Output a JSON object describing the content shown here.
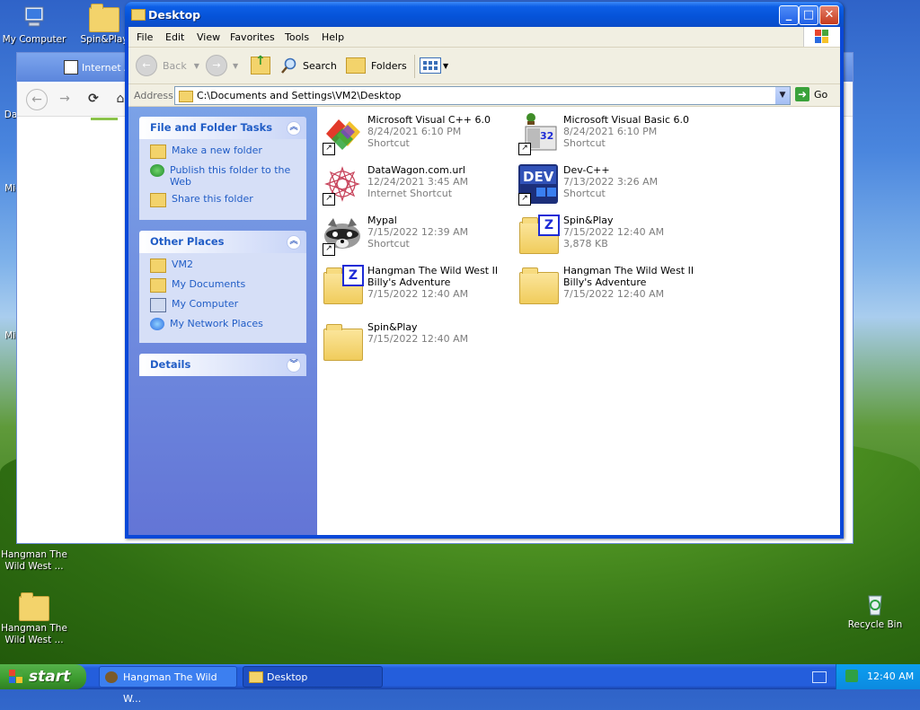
{
  "desktop": {
    "icons": [
      {
        "label": "My Computer"
      },
      {
        "label": "Spin&Play"
      },
      {
        "label": "Hangman The Wild West ..."
      },
      {
        "label": "Hangman The Wild West ..."
      },
      {
        "label": "Recycle Bin"
      }
    ],
    "partial_labels": [
      "Da",
      "Mic",
      "Mic"
    ]
  },
  "background_window": {
    "title": "Internet A"
  },
  "window": {
    "title": "Desktop",
    "controls": {
      "minimize": "_",
      "maximize": "□",
      "close": "✕"
    }
  },
  "menubar": [
    "File",
    "Edit",
    "View",
    "Favorites",
    "Tools",
    "Help"
  ],
  "toolbar": {
    "back": "Back",
    "search": "Search",
    "folders": "Folders"
  },
  "address": {
    "label": "Address",
    "value": "C:\\Documents and Settings\\VM2\\Desktop",
    "go": "Go"
  },
  "tasks_panel": {
    "title": "File and Folder Tasks",
    "links": [
      "Make a new folder",
      "Publish this folder to the Web",
      "Share this folder"
    ]
  },
  "places_panel": {
    "title": "Other Places",
    "links": [
      "VM2",
      "My Documents",
      "My Computer",
      "My Network Places"
    ]
  },
  "details_panel": {
    "title": "Details"
  },
  "files": [
    {
      "name": "Microsoft Visual C++ 6.0",
      "line2": "8/24/2021 6:10 PM",
      "line3": "Shortcut"
    },
    {
      "name": "Microsoft Visual Basic 6.0",
      "line2": "8/24/2021 6:10 PM",
      "line3": "Shortcut"
    },
    {
      "name": "DataWagon.com.url",
      "line2": "12/24/2021 3:45 AM",
      "line3": "Internet Shortcut"
    },
    {
      "name": "Dev-C++",
      "line2": "7/13/2022 3:26 AM",
      "line3": "Shortcut"
    },
    {
      "name": "Mypal",
      "line2": "7/15/2022 12:39 AM",
      "line3": "Shortcut"
    },
    {
      "name": "Spin&Play",
      "line2": "7/15/2022 12:40 AM",
      "line3": "3,878 KB"
    },
    {
      "name": "Hangman The Wild West II Billy's Adventure",
      "line2": "7/15/2022 12:40 AM",
      "line3": ""
    },
    {
      "name": "Hangman The Wild West II Billy's Adventure",
      "line2": "7/15/2022 12:40 AM",
      "line3": ""
    },
    {
      "name": "Spin&Play",
      "line2": "7/15/2022 12:40 AM",
      "line3": ""
    }
  ],
  "taskbar": {
    "start": "start",
    "tasks": [
      "Hangman The Wild W...",
      "Desktop"
    ],
    "clock": "12:40 AM"
  }
}
